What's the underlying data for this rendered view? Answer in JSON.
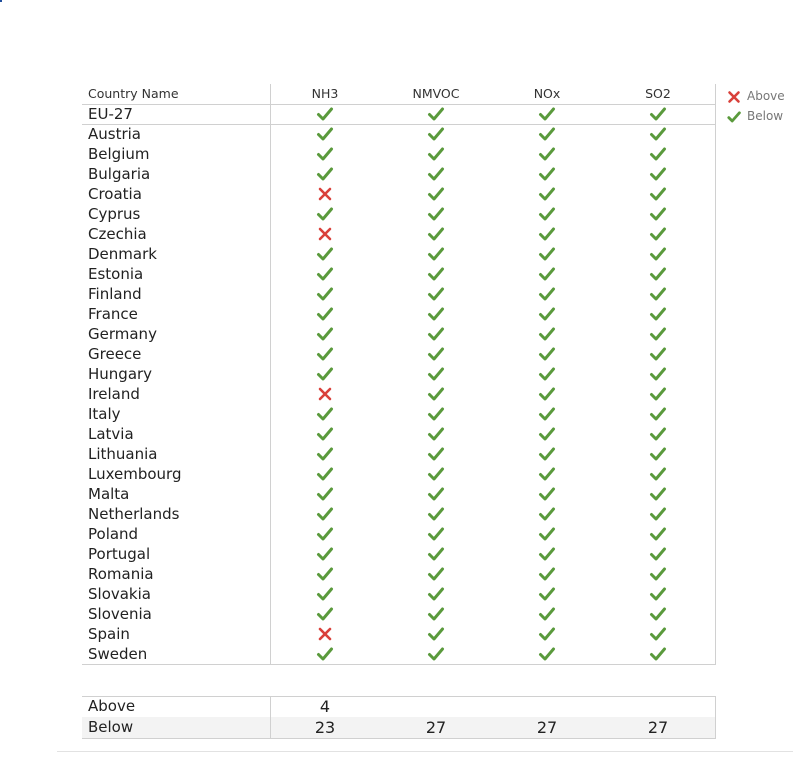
{
  "table": {
    "header_country": "Country Name",
    "columns": [
      "NH3",
      "NMVOC",
      "NOx",
      "SO2"
    ]
  },
  "legend": [
    {
      "label": "Above",
      "icon": "cross-icon",
      "color": "#d9403a"
    },
    {
      "label": "Below",
      "icon": "check-icon",
      "color": "#5a9a3c"
    }
  ],
  "colors": {
    "above": "#d9403a",
    "below": "#5a9a3c"
  },
  "chart_data": {
    "type": "table",
    "columns": [
      "NH3",
      "NMVOC",
      "NOx",
      "SO2"
    ],
    "rows": [
      {
        "country": "EU-27",
        "values": [
          "Below",
          "Below",
          "Below",
          "Below"
        ]
      },
      {
        "country": "Austria",
        "values": [
          "Below",
          "Below",
          "Below",
          "Below"
        ]
      },
      {
        "country": "Belgium",
        "values": [
          "Below",
          "Below",
          "Below",
          "Below"
        ]
      },
      {
        "country": "Bulgaria",
        "values": [
          "Below",
          "Below",
          "Below",
          "Below"
        ]
      },
      {
        "country": "Croatia",
        "values": [
          "Above",
          "Below",
          "Below",
          "Below"
        ]
      },
      {
        "country": "Cyprus",
        "values": [
          "Below",
          "Below",
          "Below",
          "Below"
        ]
      },
      {
        "country": "Czechia",
        "values": [
          "Above",
          "Below",
          "Below",
          "Below"
        ]
      },
      {
        "country": "Denmark",
        "values": [
          "Below",
          "Below",
          "Below",
          "Below"
        ]
      },
      {
        "country": "Estonia",
        "values": [
          "Below",
          "Below",
          "Below",
          "Below"
        ]
      },
      {
        "country": "Finland",
        "values": [
          "Below",
          "Below",
          "Below",
          "Below"
        ]
      },
      {
        "country": "France",
        "values": [
          "Below",
          "Below",
          "Below",
          "Below"
        ]
      },
      {
        "country": "Germany",
        "values": [
          "Below",
          "Below",
          "Below",
          "Below"
        ]
      },
      {
        "country": "Greece",
        "values": [
          "Below",
          "Below",
          "Below",
          "Below"
        ]
      },
      {
        "country": "Hungary",
        "values": [
          "Below",
          "Below",
          "Below",
          "Below"
        ]
      },
      {
        "country": "Ireland",
        "values": [
          "Above",
          "Below",
          "Below",
          "Below"
        ]
      },
      {
        "country": "Italy",
        "values": [
          "Below",
          "Below",
          "Below",
          "Below"
        ]
      },
      {
        "country": "Latvia",
        "values": [
          "Below",
          "Below",
          "Below",
          "Below"
        ]
      },
      {
        "country": "Lithuania",
        "values": [
          "Below",
          "Below",
          "Below",
          "Below"
        ]
      },
      {
        "country": "Luxembourg",
        "values": [
          "Below",
          "Below",
          "Below",
          "Below"
        ]
      },
      {
        "country": "Malta",
        "values": [
          "Below",
          "Below",
          "Below",
          "Below"
        ]
      },
      {
        "country": "Netherlands",
        "values": [
          "Below",
          "Below",
          "Below",
          "Below"
        ]
      },
      {
        "country": "Poland",
        "values": [
          "Below",
          "Below",
          "Below",
          "Below"
        ]
      },
      {
        "country": "Portugal",
        "values": [
          "Below",
          "Below",
          "Below",
          "Below"
        ]
      },
      {
        "country": "Romania",
        "values": [
          "Below",
          "Below",
          "Below",
          "Below"
        ]
      },
      {
        "country": "Slovakia",
        "values": [
          "Below",
          "Below",
          "Below",
          "Below"
        ]
      },
      {
        "country": "Slovenia",
        "values": [
          "Below",
          "Below",
          "Below",
          "Below"
        ]
      },
      {
        "country": "Spain",
        "values": [
          "Above",
          "Below",
          "Below",
          "Below"
        ]
      },
      {
        "country": "Sweden",
        "values": [
          "Below",
          "Below",
          "Below",
          "Below"
        ]
      }
    ],
    "summary": [
      {
        "label": "Above",
        "values": [
          "4",
          "",
          "",
          ""
        ]
      },
      {
        "label": "Below",
        "values": [
          "23",
          "27",
          "27",
          "27"
        ]
      }
    ]
  }
}
